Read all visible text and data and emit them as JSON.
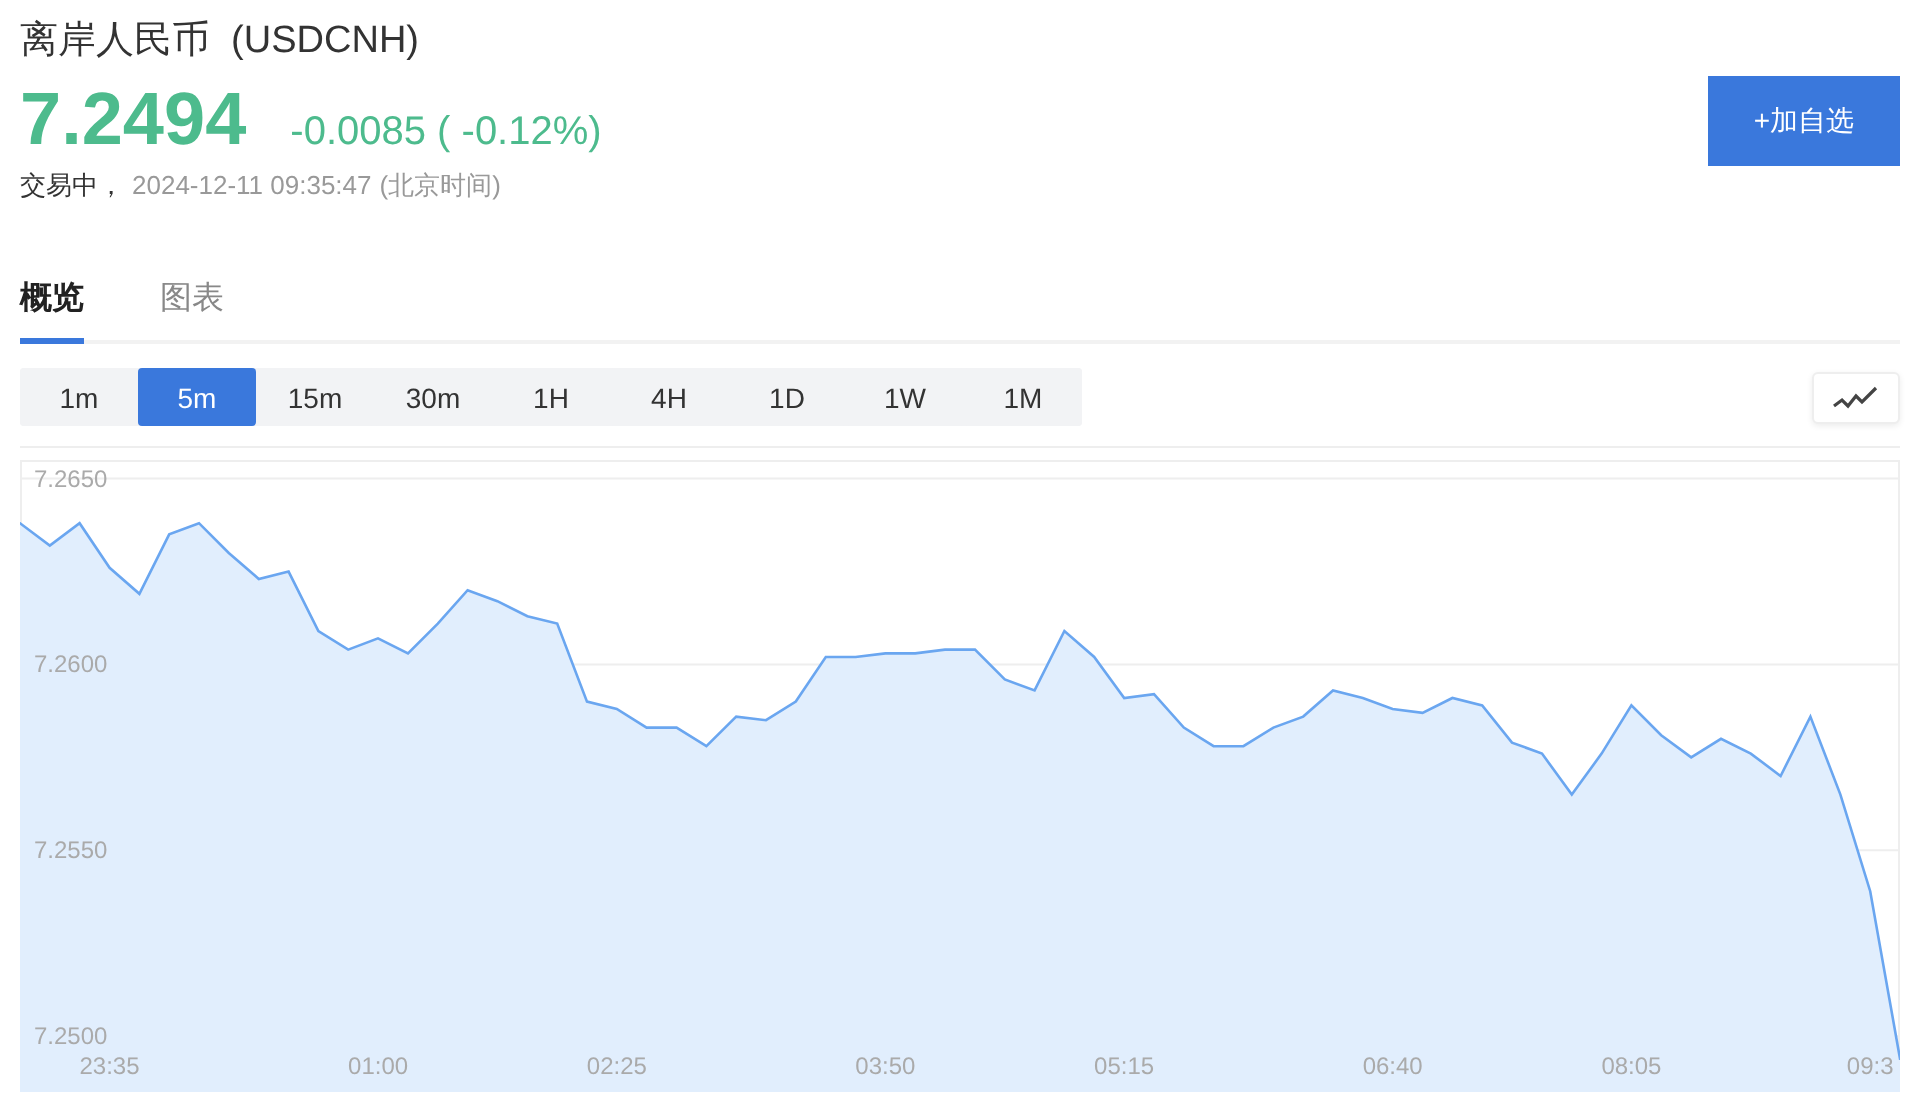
{
  "header": {
    "title": "离岸人民币  (USDCNH)",
    "price": "7.2494",
    "change": "-0.0085 ( -0.12%)",
    "status": "交易中，",
    "timestamp": "2024-12-11 09:35:47",
    "timezone": "(北京时间)",
    "watch_button": "+加自选"
  },
  "tabs": [
    {
      "label": "概览",
      "selected": true
    },
    {
      "label": "图表",
      "selected": false
    }
  ],
  "periods": [
    {
      "label": "1m",
      "selected": false
    },
    {
      "label": "5m",
      "selected": true
    },
    {
      "label": "15m",
      "selected": false
    },
    {
      "label": "30m",
      "selected": false
    },
    {
      "label": "1H",
      "selected": false
    },
    {
      "label": "4H",
      "selected": false
    },
    {
      "label": "1D",
      "selected": false
    },
    {
      "label": "1W",
      "selected": false
    },
    {
      "label": "1M",
      "selected": false
    }
  ],
  "chart": {
    "chart_data": {
      "type": "area",
      "categories": [
        null,
        null,
        null,
        "23:35",
        null,
        null,
        null,
        null,
        null,
        null,
        null,
        null,
        "01:00",
        null,
        null,
        null,
        null,
        null,
        null,
        null,
        "02:25",
        null,
        null,
        null,
        null,
        null,
        null,
        null,
        null,
        "03:50",
        null,
        null,
        null,
        null,
        null,
        null,
        null,
        "05:15",
        null,
        null,
        null,
        null,
        null,
        null,
        null,
        null,
        "06:40",
        null,
        null,
        null,
        null,
        null,
        null,
        null,
        "08:05",
        null,
        null,
        null,
        null,
        null,
        null,
        null,
        "09:3",
        null
      ],
      "series": [
        {
          "color": "#6aa6f0",
          "values": [
            7.2638,
            7.2632,
            7.2638,
            7.2626,
            7.2619,
            7.2635,
            7.2638,
            7.263,
            7.2623,
            7.2625,
            7.2609,
            7.2604,
            7.2607,
            7.2603,
            7.2611,
            7.262,
            7.2617,
            7.2613,
            7.2611,
            7.259,
            7.2588,
            7.2583,
            7.2583,
            7.2578,
            7.2586,
            7.2585,
            7.259,
            7.2602,
            7.2602,
            7.2603,
            7.2603,
            7.2604,
            7.2604,
            7.2596,
            7.2593,
            7.2609,
            7.2602,
            7.2591,
            7.2592,
            7.2583,
            7.2578,
            7.2578,
            7.2583,
            7.2586,
            7.2593,
            7.2591,
            7.2588,
            7.2587,
            7.2591,
            7.2589,
            7.2579,
            7.2576,
            7.2565,
            7.2576,
            7.2589,
            7.2581,
            7.2575,
            7.258,
            7.2576,
            7.257,
            7.2586,
            7.2565,
            7.2539,
            7.2494
          ]
        }
      ],
      "ylim": [
        7.2485,
        7.2655
      ],
      "grid": true,
      "yticks": [
        {
          "value": 7.265,
          "label": "7.2650"
        },
        {
          "value": 7.26,
          "label": "7.2600"
        },
        {
          "value": 7.255,
          "label": "7.2550"
        },
        {
          "value": 7.25,
          "label": "7.2500"
        }
      ]
    }
  }
}
